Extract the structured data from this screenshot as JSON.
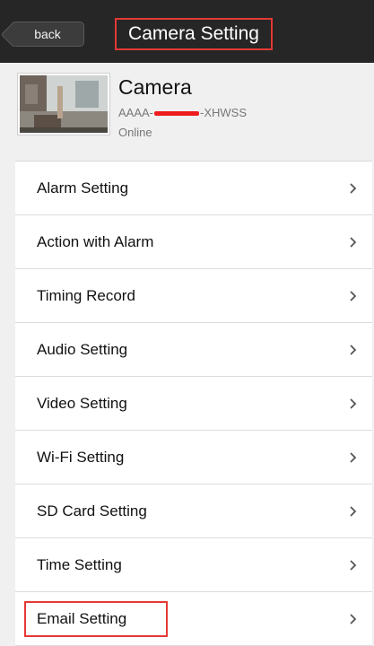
{
  "header": {
    "back_label": "back",
    "title": "Camera Setting"
  },
  "camera": {
    "name": "Camera",
    "id_prefix": "AAAA-",
    "id_suffix": "-XHWSS",
    "status": "Online"
  },
  "menu": {
    "items": [
      {
        "label": "Alarm Setting"
      },
      {
        "label": "Action with Alarm"
      },
      {
        "label": "Timing Record"
      },
      {
        "label": "Audio Setting"
      },
      {
        "label": "Video Setting"
      },
      {
        "label": "Wi-Fi Setting"
      },
      {
        "label": "SD Card Setting"
      },
      {
        "label": "Time Setting"
      },
      {
        "label": "Email Setting"
      }
    ]
  },
  "colors": {
    "header_bg": "#262626",
    "highlight": "#e53935",
    "redaction": "#ee1c1c"
  }
}
